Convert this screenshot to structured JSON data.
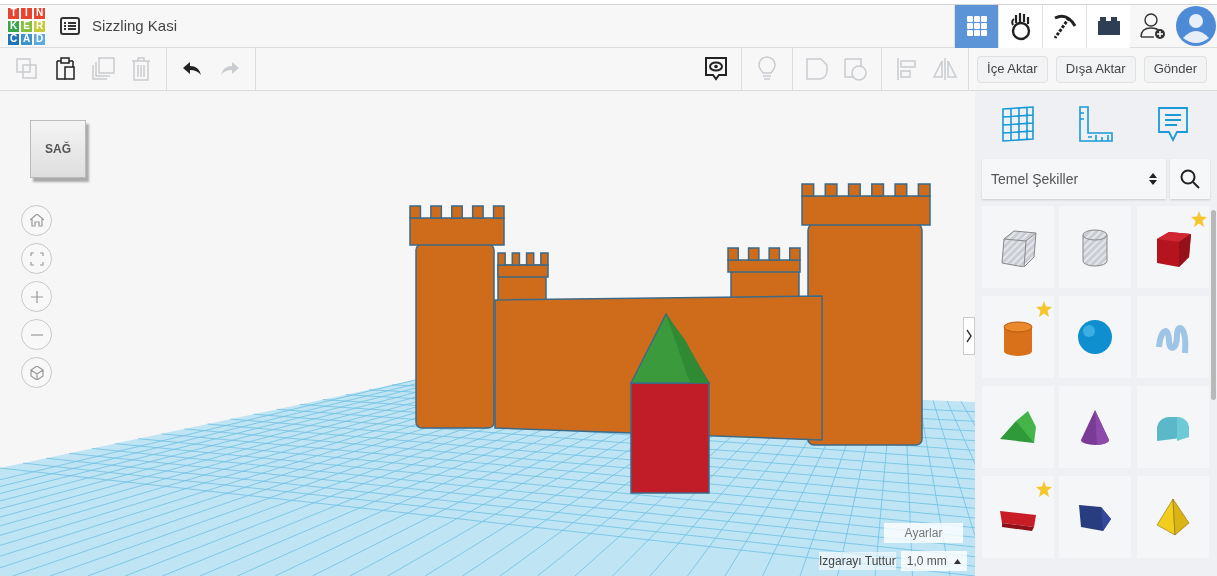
{
  "logo": {
    "letters": [
      "T",
      "I",
      "N",
      "K",
      "E",
      "R",
      "C",
      "A",
      "D"
    ]
  },
  "design_title": "Sizzling Kasi",
  "mode_tabs": [
    {
      "kind": "grid",
      "selected": true
    },
    {
      "kind": "hand",
      "selected": false
    },
    {
      "kind": "pickaxe",
      "selected": false
    },
    {
      "kind": "brick",
      "selected": false
    }
  ],
  "toolbar_left": [
    {
      "kind": "copy",
      "disabled": true
    },
    {
      "kind": "paste",
      "disabled": false
    },
    {
      "kind": "duplicate",
      "disabled": true
    },
    {
      "kind": "delete",
      "disabled": true
    },
    {
      "kind": "undo",
      "disabled": false
    },
    {
      "kind": "redo",
      "disabled": true
    }
  ],
  "toolbar_right": [
    {
      "kind": "notes",
      "disabled": false
    },
    {
      "kind": "light",
      "disabled": true
    },
    {
      "kind": "group",
      "disabled": true
    },
    {
      "kind": "ungroup",
      "disabled": true
    },
    {
      "kind": "align",
      "disabled": true
    },
    {
      "kind": "mirror",
      "disabled": true
    }
  ],
  "buttons": [
    "İçe Aktar",
    "Dışa Aktar",
    "Gönder"
  ],
  "view_cube": {
    "label": "SAĞ"
  },
  "view_controls": [
    {
      "kind": "home"
    },
    {
      "kind": "fit"
    },
    {
      "kind": "zoom_in"
    },
    {
      "kind": "zoom_out"
    },
    {
      "kind": "perspective"
    }
  ],
  "panel_tabs": [
    {
      "kind": "workplane"
    },
    {
      "kind": "ruler"
    },
    {
      "kind": "notes"
    }
  ],
  "library_select": {
    "value": "Temel Şekiller"
  },
  "shapes": [
    {
      "kind": "box_hole",
      "favorite": false
    },
    {
      "kind": "cylinder_hole",
      "favorite": false
    },
    {
      "kind": "box",
      "favorite": true
    },
    {
      "kind": "cylinder",
      "favorite": true
    },
    {
      "kind": "sphere",
      "favorite": false
    },
    {
      "kind": "scribble",
      "favorite": false
    },
    {
      "kind": "roof",
      "favorite": false
    },
    {
      "kind": "cone",
      "favorite": false
    },
    {
      "kind": "round_roof",
      "favorite": false
    },
    {
      "kind": "text",
      "favorite": true
    },
    {
      "kind": "prism",
      "favorite": false
    },
    {
      "kind": "pyramid",
      "favorite": false
    }
  ],
  "settings_button": "Ayarlar",
  "snap_grid": {
    "label": "Izgarayı Tuttur",
    "value": "1,0 mm"
  }
}
